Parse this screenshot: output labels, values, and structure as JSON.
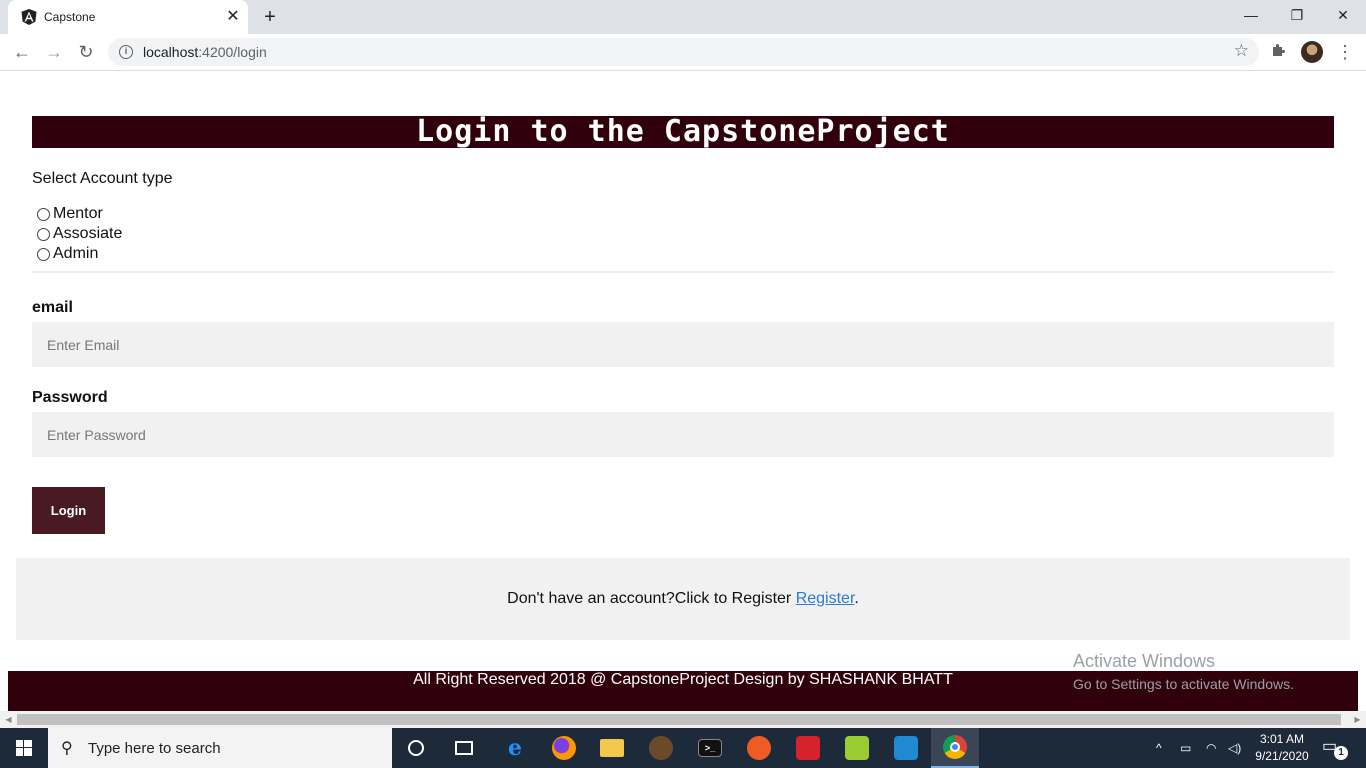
{
  "browser": {
    "tab_title": "Capstone",
    "tab_close": "✕",
    "new_tab": "+",
    "url_host": "localhost",
    "url_rest": ":4200/login",
    "window_controls": {
      "minimize": "—",
      "maximize": "❐",
      "close": "✕"
    }
  },
  "page": {
    "banner_title": "Login to the CapstoneProject",
    "account_type_label": "Select Account type",
    "account_options": [
      "Mentor",
      "Assosiate",
      "Admin"
    ],
    "email_label": "email",
    "email_placeholder": "Enter Email",
    "password_label": "Password",
    "password_placeholder": "Enter Password",
    "login_button": "Login",
    "register_prompt": "Don't have an account?Click to Register ",
    "register_link": "Register",
    "register_period": ".",
    "footer_text": "All Right Reserved 2018 @ CapstoneProject Design by SHASHANK BHATT",
    "brand_color": "#30000d",
    "button_color": "#4a1a22",
    "link_color": "#2b7bd3"
  },
  "watermark": {
    "line1": "Activate Windows",
    "line2": "Go to Settings to activate Windows."
  },
  "taskbar": {
    "search_placeholder": "Type here to search",
    "clock_time": "3:01 AM",
    "clock_date": "9/21/2020",
    "notification_count": "1",
    "pinned_apps": [
      "task-view",
      "edge",
      "firefox",
      "file-explorer",
      "game-app",
      "terminal",
      "postman",
      "acrobat",
      "notepad-plus",
      "vscode",
      "chrome"
    ]
  }
}
